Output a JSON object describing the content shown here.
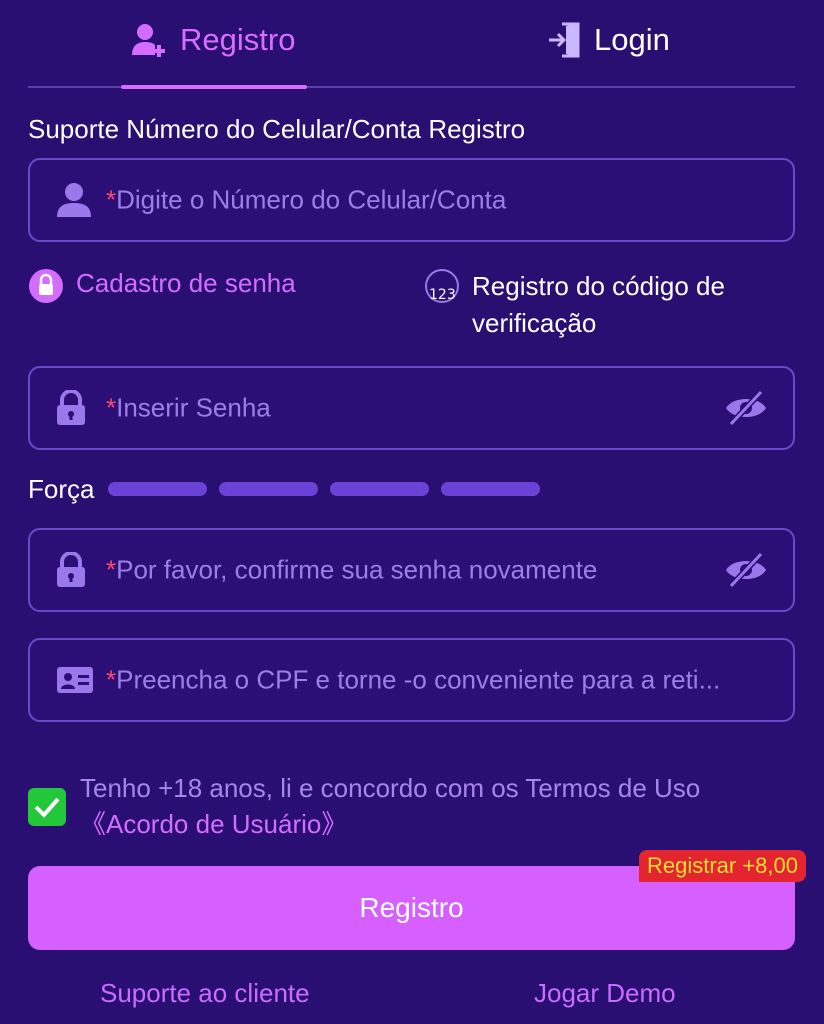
{
  "tabs": {
    "register_label": "Registro",
    "login_label": "Login"
  },
  "form": {
    "support_label": "Suporte Número do Celular/Conta Registro",
    "account_placeholder": "Digite o Número do Celular/Conta",
    "required_mark": "*",
    "options": {
      "password_label": "Cadastro de senha",
      "code_label_line1": "Registro do código de",
      "code_label_line2": "verificação",
      "code_badge": "123"
    },
    "password_placeholder": "Inserir Senha",
    "strength_label": "Força",
    "confirm_placeholder": "Por favor, confirme sua senha novamente",
    "cpf_placeholder": "Preencha o CPF e torne -o conveniente para a reti..."
  },
  "agreement": {
    "text": "Tenho +18 anos, li e concordo com os Termos de Uso",
    "link": "《Acordo de Usuário》",
    "checked": true
  },
  "submit": {
    "label": "Registro",
    "bonus_badge": "Registrar +8,00"
  },
  "footer": {
    "support_link": "Suporte ao cliente",
    "demo_link": "Jogar Demo"
  },
  "colors": {
    "background": "#2a0f73",
    "accent": "#d65fff",
    "checkbox": "#22c73a",
    "bonus": "#e4252f"
  }
}
